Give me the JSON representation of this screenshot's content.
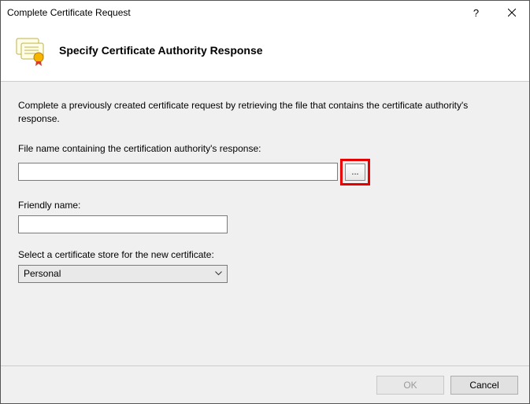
{
  "titlebar": {
    "title": "Complete Certificate Request",
    "help": "?",
    "close": "×"
  },
  "header": {
    "title": "Specify Certificate Authority Response"
  },
  "content": {
    "description": "Complete a previously created certificate request by retrieving the file that contains the certificate authority's response.",
    "file_label": "File name containing the certification authority's response:",
    "file_value": "",
    "browse_label": "...",
    "friendly_label": "Friendly name:",
    "friendly_value": "",
    "store_label": "Select a certificate store for the new certificate:",
    "store_selected": "Personal"
  },
  "footer": {
    "ok": "OK",
    "cancel": "Cancel"
  }
}
